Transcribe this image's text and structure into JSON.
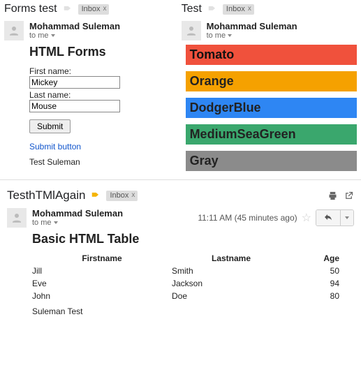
{
  "top_left": {
    "subject": "Forms test",
    "inbox_chip": "Inbox",
    "inbox_x": "x",
    "sender": "Mohammad Suleman",
    "to_line": "to me",
    "heading": "HTML Forms",
    "label_first": "First name:",
    "value_first": "Mickey",
    "label_last": "Last name:",
    "value_last": "Mouse",
    "submit_label": "Submit",
    "link_text": "Submit button",
    "footer_line": "Test Suleman"
  },
  "top_right": {
    "subject": "Test",
    "inbox_chip": "Inbox",
    "inbox_x": "x",
    "sender": "Mohammad Suleman",
    "to_line": "to me",
    "bars": {
      "tomato": "Tomato",
      "orange": "Orange",
      "dblue": "DodgerBlue",
      "msea": "MediumSeaGreen",
      "gray": "Gray"
    }
  },
  "bottom": {
    "subject": "TesthTMlAgain",
    "inbox_chip": "Inbox",
    "inbox_x": "x",
    "sender": "Mohammad Suleman",
    "to_line": "to me",
    "timestamp": "11:11 AM (45 minutes ago)",
    "heading": "Basic HTML Table",
    "columns": {
      "first": "Firstname",
      "last": "Lastname",
      "age": "Age"
    },
    "rows": [
      {
        "first": "Jill",
        "last": "Smith",
        "age": "50"
      },
      {
        "first": "Eve",
        "last": "Jackson",
        "age": "94"
      },
      {
        "first": "John",
        "last": "Doe",
        "age": "80"
      }
    ],
    "footer_line": "Suleman Test"
  }
}
